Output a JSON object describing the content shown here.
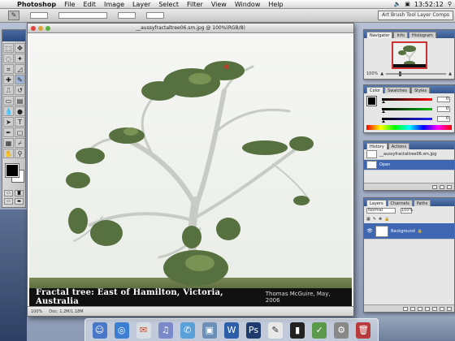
{
  "menubar": {
    "app": "Photoshop",
    "items": [
      "File",
      "Edit",
      "Image",
      "Layer",
      "Select",
      "Filter",
      "View",
      "Window",
      "Help"
    ],
    "clock": "13:52:12"
  },
  "options": {
    "preset_label": "Art Brush Tool Layer Comps"
  },
  "document": {
    "title": "__aussyfractaltree06.sm.jpg @ 100%(RGB/8)",
    "caption_title": "Fractal tree: East of Hamilton, Victoria, Australia",
    "caption_credit": "Thomas McGuire, May, 2006",
    "zoom": "100%",
    "doc_size": "Doc: 1.2M/1.18M"
  },
  "navigator": {
    "tabs": [
      "Navigator",
      "Info",
      "Histogram"
    ],
    "zoom": "100%"
  },
  "color": {
    "tabs": [
      "Color",
      "Swatches",
      "Styles"
    ],
    "values": [
      0,
      0,
      0
    ],
    "slider_colors": [
      "#d22",
      "#2a2",
      "#22c"
    ]
  },
  "history": {
    "tabs": [
      "History",
      "Actions"
    ],
    "snapshot": "__aussyfractaltree06.sm.jpg",
    "steps": [
      "Open"
    ]
  },
  "layers": {
    "tabs": [
      "Layers",
      "Channels",
      "Paths"
    ],
    "blend": "Normal",
    "opacity": "100%",
    "rows": [
      "Background"
    ]
  },
  "dock": {
    "icons": [
      "finder-icon",
      "safari-icon",
      "mail-icon",
      "itunes-icon",
      "ichat-icon",
      "iphoto-icon",
      "word-icon",
      "photoshop-icon",
      "textedit-icon",
      "terminal-icon",
      "preview-icon",
      "system-prefs-icon",
      "trash-icon"
    ]
  },
  "colors": {
    "accent": "#3f66b0",
    "caption_bg": "#111111",
    "foliage": "#4f6b3a",
    "trunk": "#c9ccc6"
  }
}
